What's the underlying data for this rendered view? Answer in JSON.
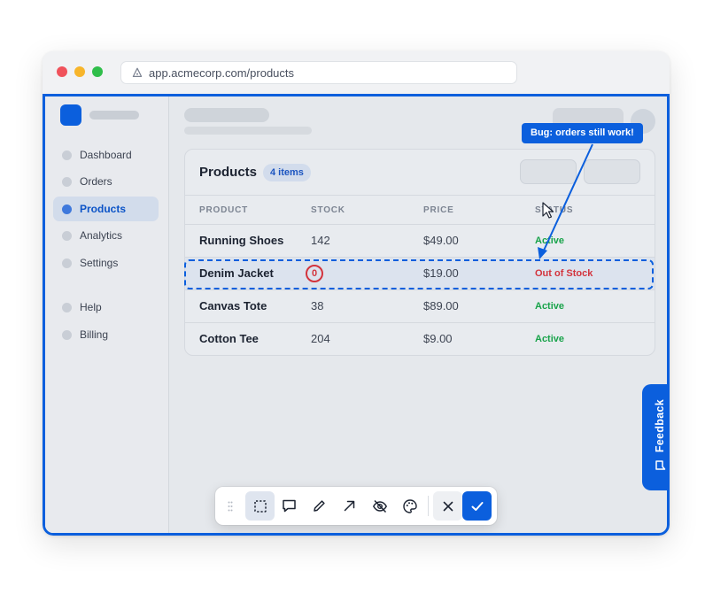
{
  "browser": {
    "url": "app.acmecorp.com/products"
  },
  "sidebar": {
    "items": [
      {
        "label": "Dashboard",
        "icon": "dot-icon"
      },
      {
        "label": "Orders",
        "icon": "dot-icon"
      },
      {
        "label": "Products",
        "icon": "dot-icon",
        "active": true
      },
      {
        "label": "Analytics",
        "icon": "dot-icon"
      },
      {
        "label": "Settings",
        "icon": "dot-icon"
      },
      {
        "label": "Help",
        "icon": "dot-icon"
      },
      {
        "label": "Billing",
        "icon": "dot-icon"
      }
    ]
  },
  "products": {
    "title": "Products",
    "count_badge": "4 items",
    "columns": [
      "PRODUCT",
      "STOCK",
      "PRICE",
      "STATUS"
    ],
    "rows": [
      {
        "name": "Running Shoes",
        "stock": "142",
        "price": "$49.00",
        "status": "Active"
      },
      {
        "name": "Denim Jacket",
        "stock": "0",
        "price": "$19.00",
        "status": "Out of Stock"
      },
      {
        "name": "Canvas Tote",
        "stock": "38",
        "price": "$89.00",
        "status": "Active"
      },
      {
        "name": "Cotton Tee",
        "stock": "204",
        "price": "$9.00",
        "status": "Active"
      }
    ]
  },
  "annotation": {
    "callout_text": "Bug: orders still work!"
  },
  "feedback": {
    "label": "Feedback"
  },
  "toolbar": {
    "tools": [
      "grip-icon",
      "select-area-icon",
      "comment-icon",
      "pencil-icon",
      "arrow-icon",
      "hide-icon",
      "palette-icon",
      "close-icon",
      "check-icon"
    ]
  },
  "colors": {
    "accent": "#0b5fdd",
    "active_status": "#18a34a",
    "out_of_stock": "#d3343d"
  }
}
